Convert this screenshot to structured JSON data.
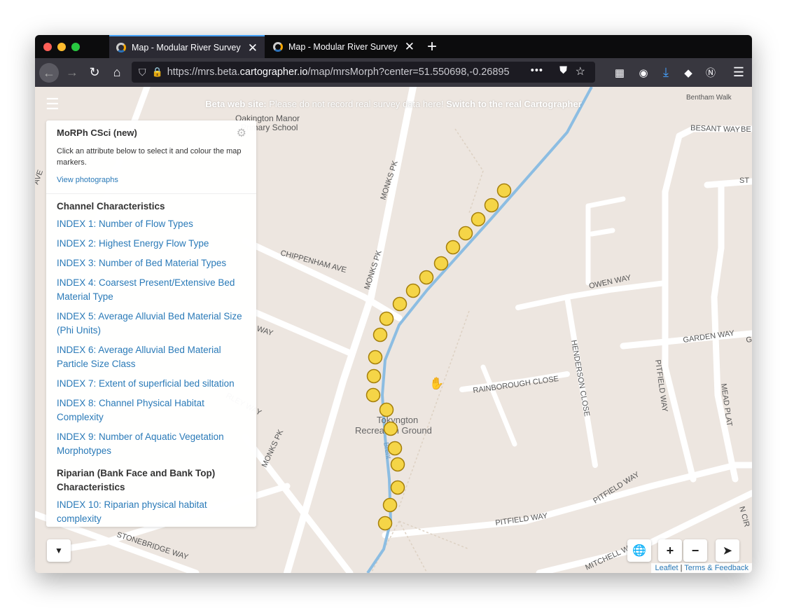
{
  "browser": {
    "tabs": [
      {
        "title": "Map - Modular River Survey",
        "active": true
      },
      {
        "title": "Map - Modular River Survey",
        "active": false
      }
    ],
    "url_prefix": "https://mrs.beta.",
    "url_host": "cartographer.io",
    "url_path": "/map/mrsMorph?center=51.550698,-0.26895",
    "icons": [
      "back-icon",
      "forward-icon",
      "reload-icon",
      "home-icon",
      "shield-icon",
      "lock-icon",
      "more-icon",
      "pocket-icon",
      "bookmark-star-icon",
      "extensions-icon",
      "download-icon",
      "menu-icon"
    ]
  },
  "banner": {
    "bold_prefix": "Beta web site:",
    "text": " Please do not record real survey data here! ",
    "link": "Switch to the real Cartographer"
  },
  "panel": {
    "title": "MoRPh CSci (new)",
    "description": "Click an attribute below to select it and colour the map markers.",
    "view_photographs": "View photographs",
    "sections": [
      {
        "heading": "Channel Characteristics",
        "items": [
          "INDEX 1: Number of Flow Types",
          "INDEX 2: Highest Energy Flow Type",
          "INDEX 3: Number of Bed Material Types",
          "INDEX 4: Coarsest Present/Extensive Bed Material Type",
          "INDEX 5: Average Alluvial Bed Material Size (Phi Units)",
          "INDEX 6: Average Alluvial Bed Material Particle Size Class",
          "INDEX 7: Extent of superficial bed siltation",
          "INDEX 8: Channel Physical Habitat Complexity",
          "INDEX 9: Number of Aquatic Vegetation Morphotypes"
        ]
      },
      {
        "heading": "Riparian (Bank Face and Bank Top) Characteristics",
        "items": [
          "INDEX 10: Riparian physical habitat complexity"
        ]
      }
    ]
  },
  "map": {
    "labels": {
      "school_1": "Oakington Manor",
      "school_2": "Primary School",
      "monks_pk_1": "MONKS PK",
      "monks_pk_2": "MONKS PK",
      "monks_pk_3": "MONKS PK",
      "chippenham": "CHIPPENHAM AVE",
      "owen_way": "OWEN WAY",
      "garden_way": "GARDEN WAY",
      "henderson": "HENDERSON CLOSE",
      "rainborough": "RAINBOROUGH CLOSE",
      "pitfield_way_1": "PITFIELD WAY",
      "pitfield_way_2": "PITFIELD WAY",
      "pitfield_way_3": "PITFIELD WAY",
      "mead_plat": "MEAD PLAT",
      "stonebridge": "STONEBRIDGE WAY",
      "mitchell": "MITCHELL WAY",
      "besant": "BESANT WAY",
      "bentham": "Bentham Walk",
      "tokyngton_1": "Tokyngton",
      "tokyngton_2": "Recreation Ground",
      "brent": "Brent",
      "way_partial": "WAY",
      "st_partial": "ST",
      "be_partial": "BE",
      "ga_partial": "GA",
      "n_cir": "N CIR",
      "ave_partial": "AVE",
      "rley_way": "RLEY WAY"
    },
    "marker_count": 26,
    "colors": {
      "marker_fill": "#f5d547",
      "marker_stroke": "#a57f0b",
      "river": "#8cbde2",
      "road": "#ffffff",
      "background": "#ede6e0"
    },
    "attribution_link": "Leaflet",
    "attribution_rest": "Terms & Feedback"
  }
}
